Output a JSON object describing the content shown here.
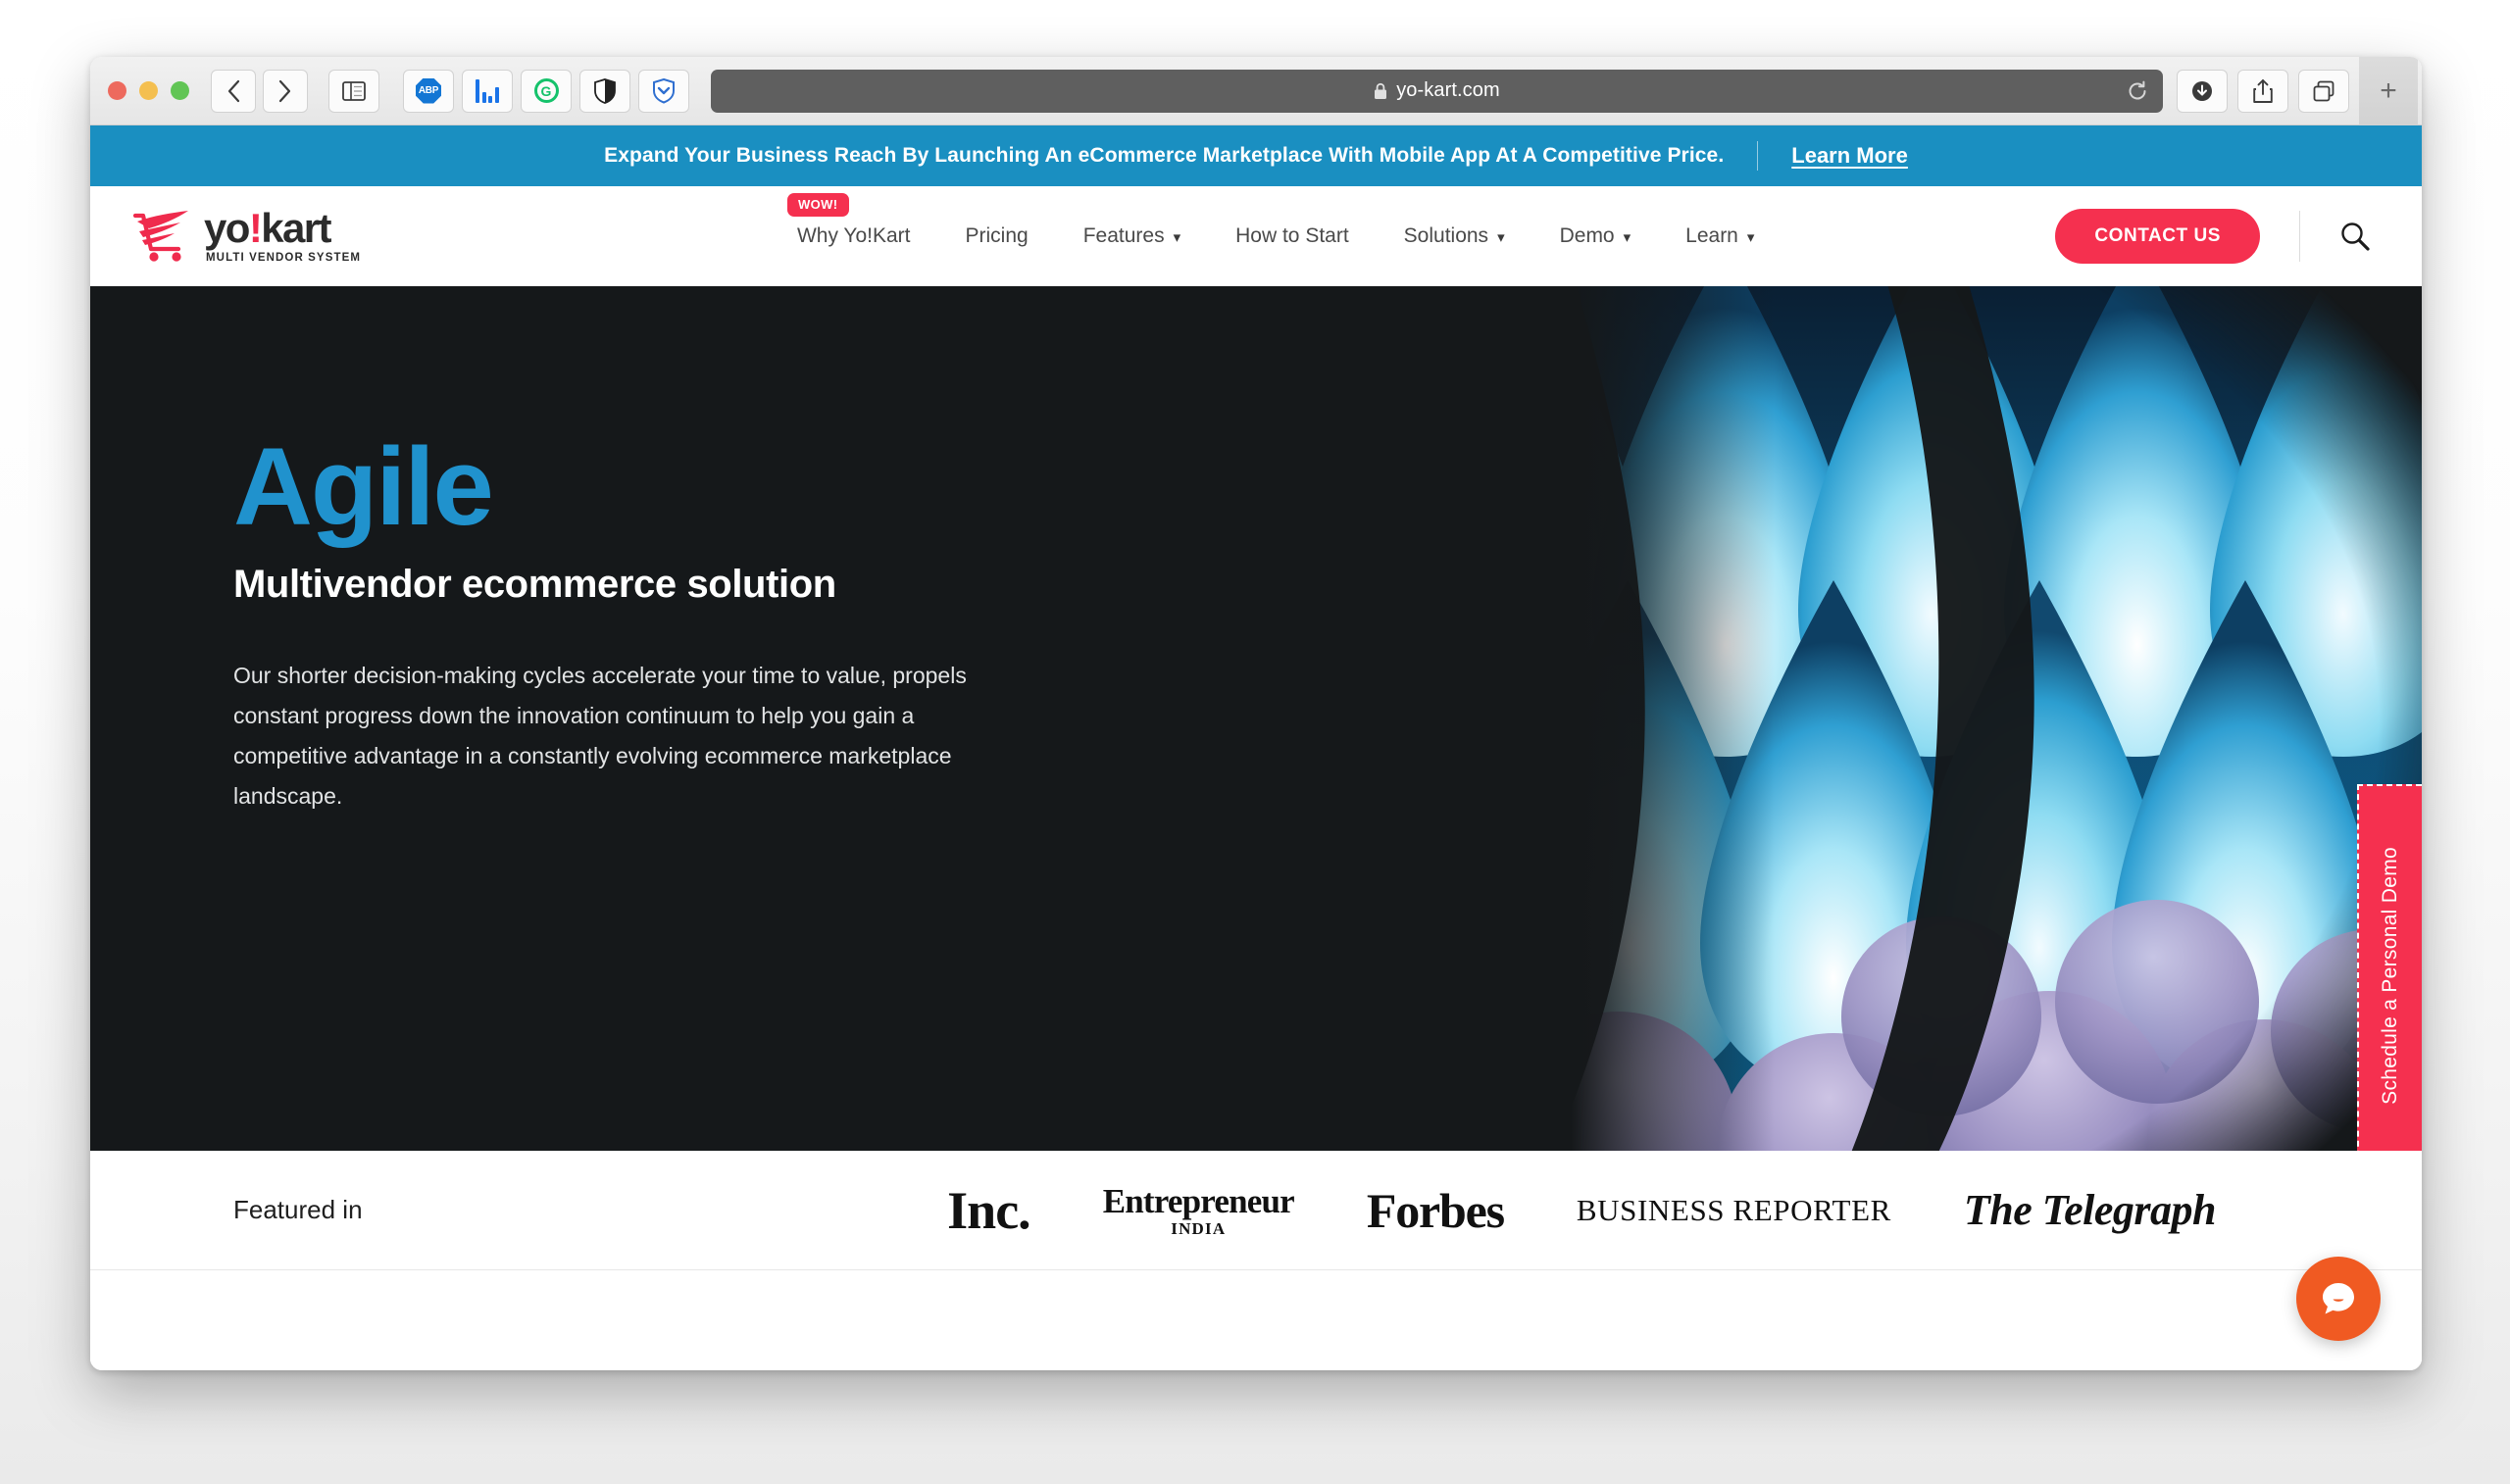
{
  "browser": {
    "url": "yo-kart.com",
    "lock_icon": "lock-icon",
    "back_icon": "chevron-left-icon",
    "forward_icon": "chevron-right-icon",
    "sidebar_icon": "sidebar-icon",
    "reload_icon": "reload-icon",
    "downloads_icon": "download-icon",
    "share_icon": "share-icon",
    "tabs_overview_icon": "tab-overview-icon",
    "new_tab_icon": "plus-icon",
    "extensions": [
      {
        "name": "adblock-plus-extension",
        "glyph": "ABP"
      },
      {
        "name": "bars-extension",
        "glyph": "bars-icon"
      },
      {
        "name": "grammarly-extension",
        "glyph": "G"
      },
      {
        "name": "shield-extension",
        "glyph": "shield-icon"
      },
      {
        "name": "pocket-extension",
        "glyph": "pocket-icon"
      }
    ],
    "traffic_lights": [
      "close",
      "minimize",
      "maximize"
    ]
  },
  "announcement": {
    "text": "Expand Your Business Reach By Launching An eCommerce Marketplace With Mobile App At A Competitive Price.",
    "link_label": "Learn More",
    "background_color": "#1a8fc1"
  },
  "header": {
    "logo": {
      "wordmark_before": "yo",
      "wordmark_bang": "!",
      "wordmark_after": "kart",
      "tagline": "MULTI VENDOR SYSTEM",
      "cart_color": "#ef2b4d"
    },
    "badge": "WOW!",
    "nav": [
      {
        "label": "Why Yo!Kart",
        "has_caret": false,
        "badge": "WOW!"
      },
      {
        "label": "Pricing",
        "has_caret": false
      },
      {
        "label": "Features",
        "has_caret": true
      },
      {
        "label": "How to Start",
        "has_caret": false
      },
      {
        "label": "Solutions",
        "has_caret": true
      },
      {
        "label": "Demo",
        "has_caret": true
      },
      {
        "label": "Learn",
        "has_caret": true
      }
    ],
    "contact_button": "CONTACT US",
    "search_icon": "search-icon",
    "accent_color": "#f5304f"
  },
  "hero": {
    "title": "Agile",
    "title_color": "#2092cd",
    "subtitle": "Multivendor ecommerce solution",
    "paragraph": "Our shorter decision-making cycles accelerate your time to value, propels constant progress down the innovation continuum to help you gain a competitive advantage in a constantly evolving ecommerce marketplace landscape.",
    "background_color": "#15181a",
    "side_tab_label": "Schedule a Personal Demo"
  },
  "featured": {
    "label": "Featured in",
    "publications": [
      {
        "name": "inc",
        "text": "Inc."
      },
      {
        "name": "entrepreneur-india",
        "text": "Entrepreneur",
        "sub": "INDIA"
      },
      {
        "name": "forbes",
        "text": "Forbes"
      },
      {
        "name": "business-reporter",
        "text": "BUSINESS  REPORTER"
      },
      {
        "name": "the-telegraph",
        "text": "The Telegraph"
      }
    ]
  },
  "chat": {
    "icon": "chat-bubble-icon",
    "color": "#f05a22"
  }
}
